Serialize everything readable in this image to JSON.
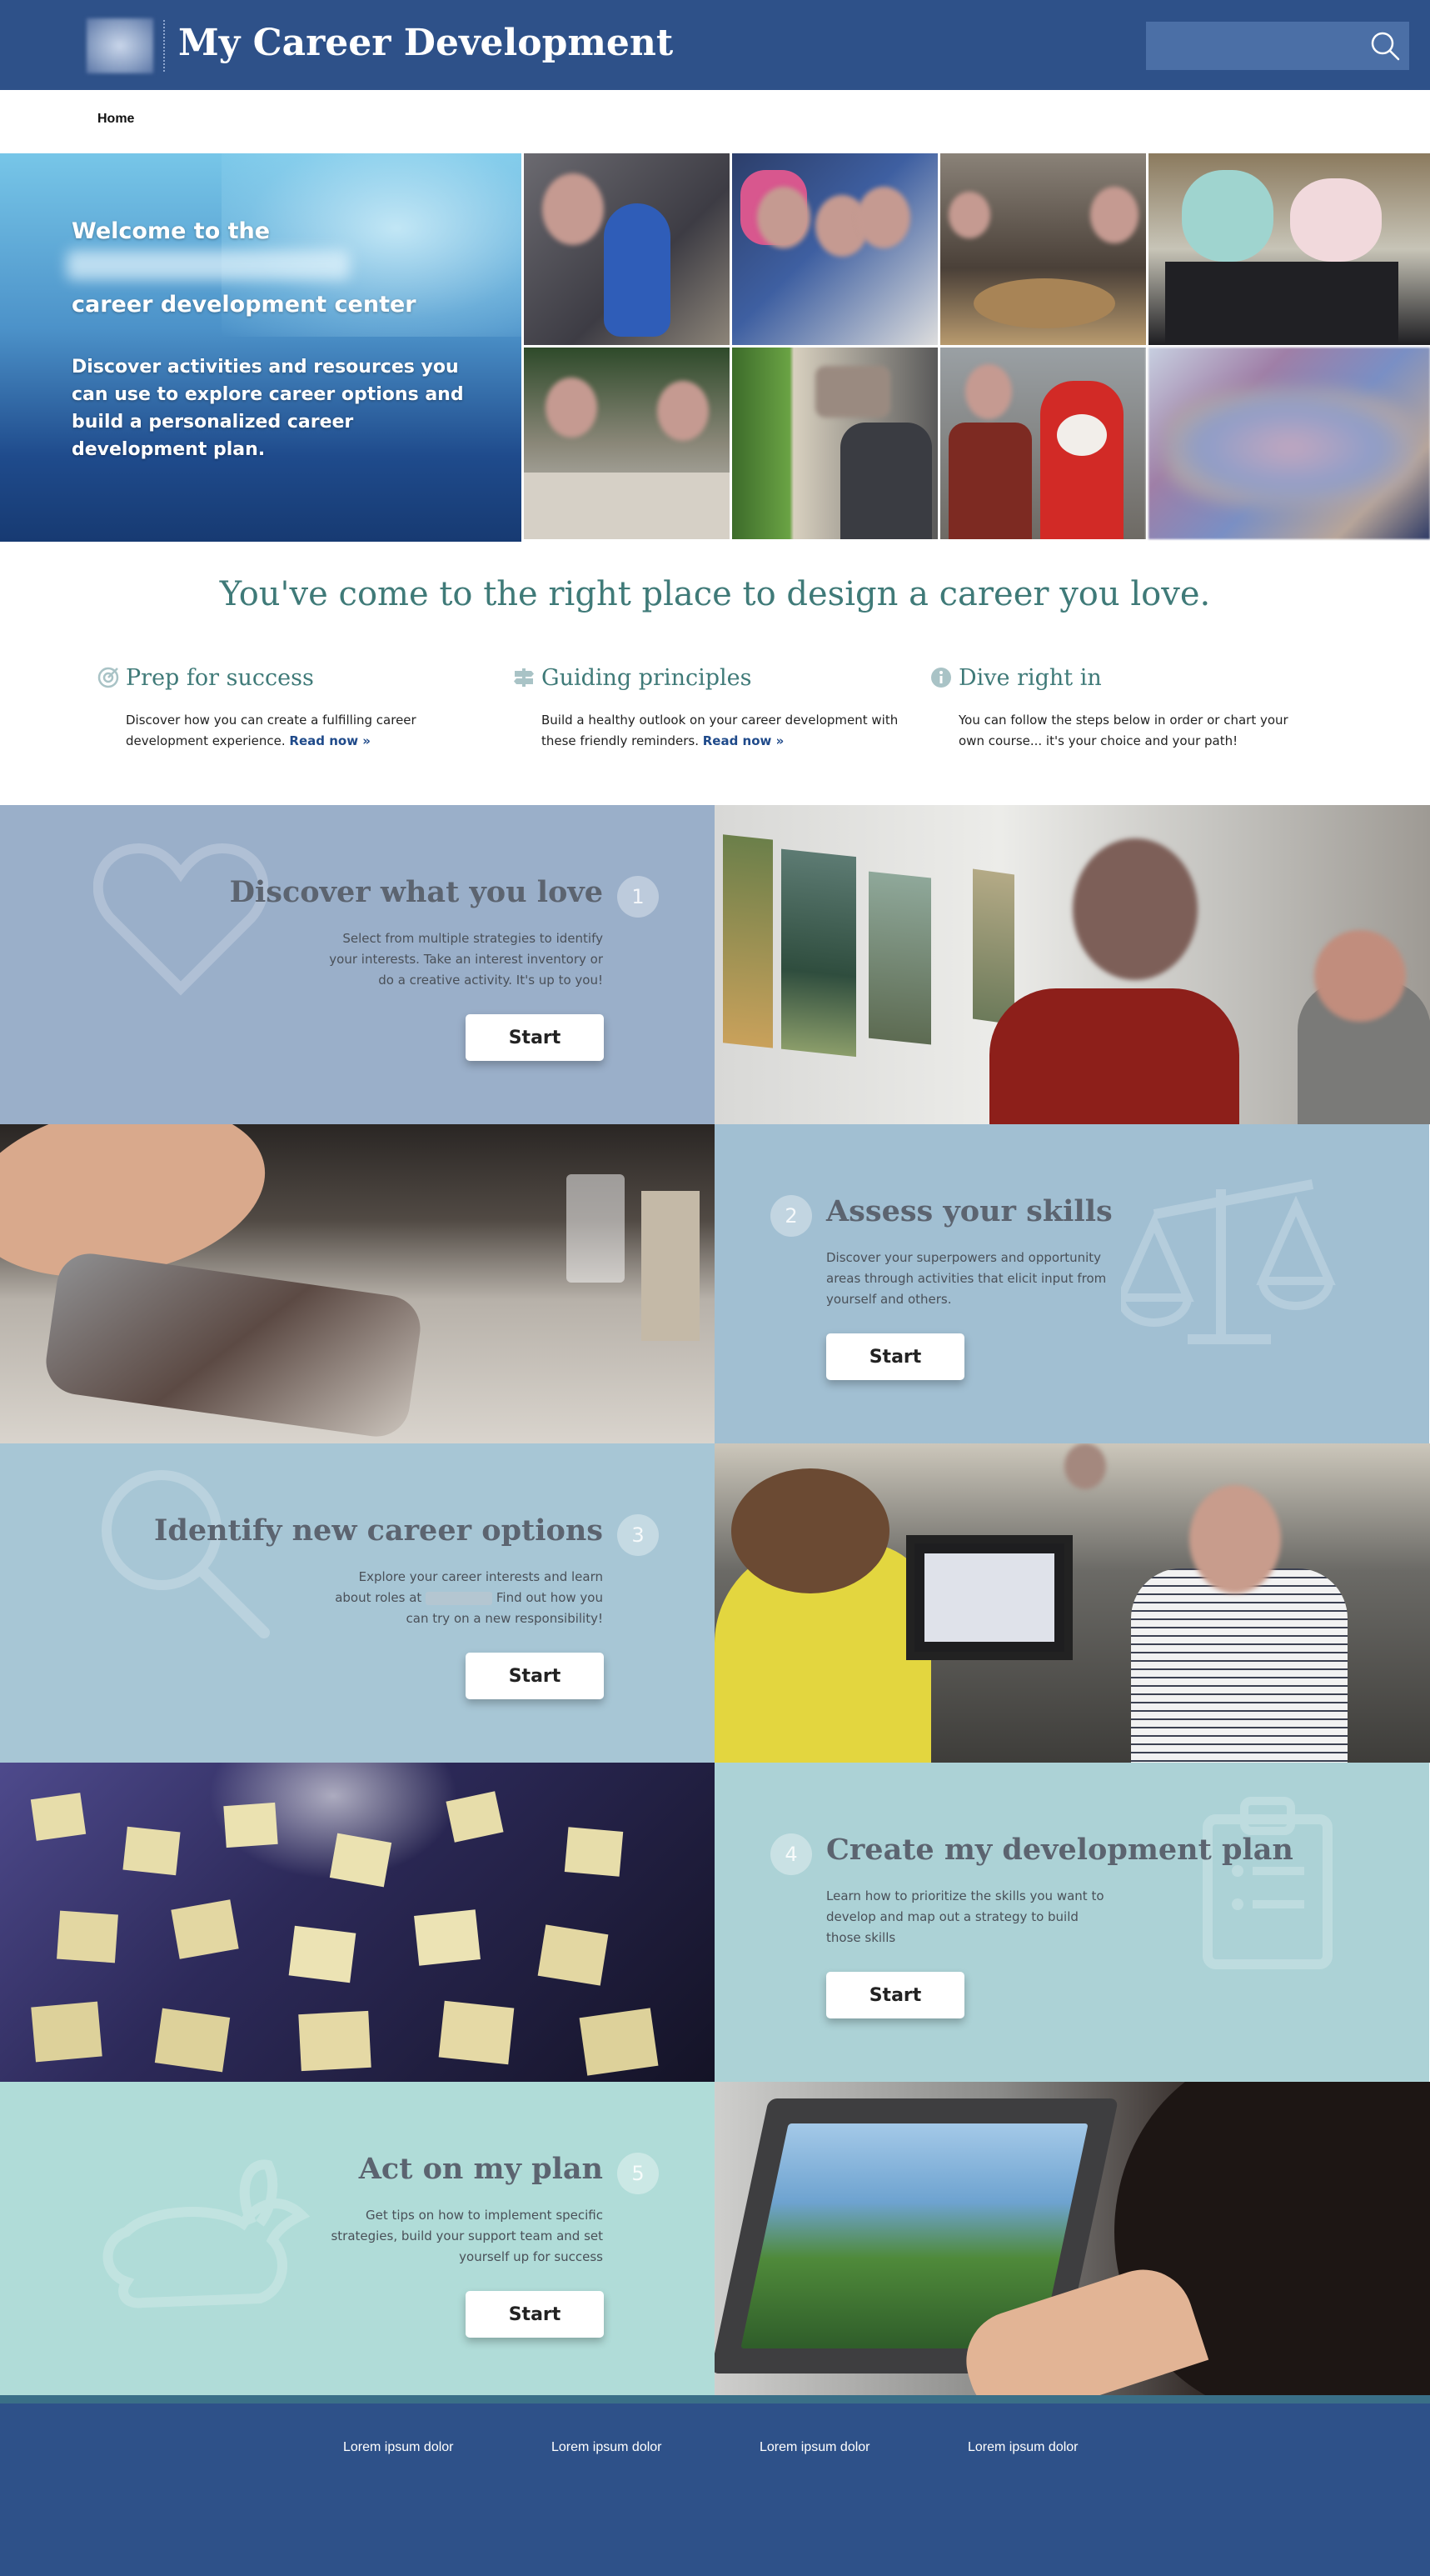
{
  "header": {
    "title": "My Career Development",
    "search_placeholder": "",
    "search_icon": "search-icon",
    "color": "#2e5189"
  },
  "nav": {
    "home": "Home"
  },
  "hero": {
    "welcome": "Welcome to the",
    "center": "career development center",
    "description": "Discover activities and resources you can use to explore career options and build a personalized career development plan."
  },
  "intro": {
    "tagline": "You've come to the right place to design a career you love.",
    "accent_color": "#3f7a78",
    "columns": [
      {
        "icon": "target-icon",
        "title": "Prep for success",
        "text": "Discover how you can create a fulfilling career development experience.",
        "link": "Read now »"
      },
      {
        "icon": "signpost-icon",
        "title": "Guiding principles",
        "text": "Build a healthy outlook on your career development with these friendly reminders.",
        "link": "Read now »"
      },
      {
        "icon": "info-icon",
        "title": "Dive right in",
        "text": "You can follow the steps below in order or chart your own course... it's your choice and your path!",
        "link": ""
      }
    ]
  },
  "steps": [
    {
      "number": "1",
      "title": "Discover what you love",
      "description": "Select from multiple strategies to identify your interests. Take an interest inventory or do a creative activity. It's up to you!",
      "button": "Start",
      "icon": "heart-icon",
      "color": "#9aafc9"
    },
    {
      "number": "2",
      "title": "Assess your skills",
      "description": "Discover your superpowers and opportunity areas through activities that elicit input from yourself and others.",
      "button": "Start",
      "icon": "scale-icon",
      "color": "#a1bfd2"
    },
    {
      "number": "3",
      "title": "Identify new career options",
      "description_before": "Explore your career interests and learn about roles at",
      "description_after": "Find out how you can try on a new responsibility!",
      "button": "Start",
      "icon": "magnifier-icon",
      "color": "#a7c6d5"
    },
    {
      "number": "4",
      "title": "Create my development plan",
      "description": "Learn how to prioritize the skills you want to develop and map out a strategy to build those skills",
      "button": "Start",
      "icon": "clipboard-icon",
      "color": "#acd2d6"
    },
    {
      "number": "5",
      "title": "Act on my plan",
      "description": "Get tips on how to implement specific strategies, build your support team and set yourself up for success",
      "button": "Start",
      "icon": "rabbit-icon",
      "color": "#b0dcd8"
    }
  ],
  "footer": {
    "links": [
      "Lorem ipsum dolor",
      "Lorem ipsum dolor",
      "Lorem ipsum dolor",
      "Lorem ipsum dolor"
    ],
    "color": "#2e5189"
  }
}
